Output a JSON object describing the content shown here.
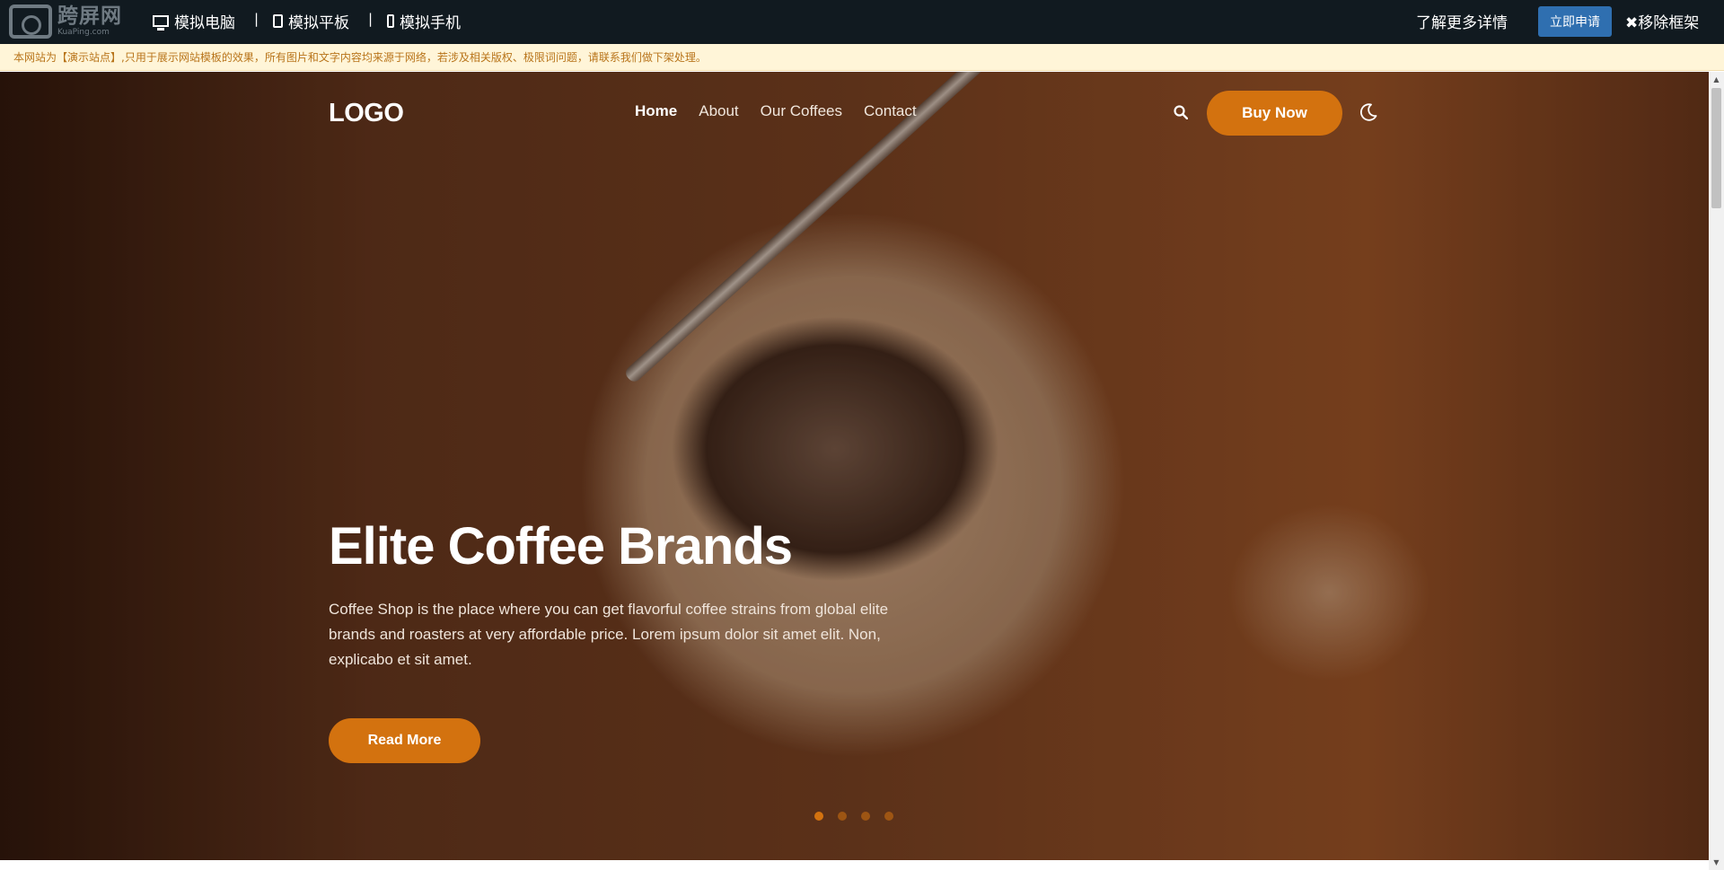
{
  "topbar": {
    "logo_cn": "跨屏网",
    "logo_en": "KuaPing.com",
    "sim_pc": "模拟电脑",
    "sim_tablet": "模拟平板",
    "sim_phone": "模拟手机",
    "separator": "|",
    "more_label": "了解更多详情",
    "apply_label": "立即申请",
    "remove_label": "✖移除框架"
  },
  "notice": {
    "text": "本网站为【演示站点】,只用于展示网站模板的效果，所有图片和文字内容均来源于网络，若涉及相关版权、极限词问题，请联系我们做下架处理。"
  },
  "site": {
    "logo": "LOGO",
    "nav": [
      "Home",
      "About",
      "Our Coffees",
      "Contact"
    ],
    "active_nav": "Home",
    "buy_label": "Buy Now",
    "icons": {
      "search": "search-icon",
      "theme": "moon-icon"
    }
  },
  "hero": {
    "title": "Elite Coffee Brands",
    "text": "Coffee Shop is the place where you can get flavorful coffee strains from global elite brands and roasters at very affordable price. Lorem ipsum dolor sit amet elit. Non, explicabo et sit amet.",
    "read_more_label": "Read More",
    "slides_count": 4,
    "active_slide": 1
  },
  "colors": {
    "accent": "#d3720f",
    "topbar_bg": "#111a20",
    "apply_bg": "#2f6fb0",
    "notice_bg": "#fff5d8",
    "notice_text": "#b8741a"
  }
}
